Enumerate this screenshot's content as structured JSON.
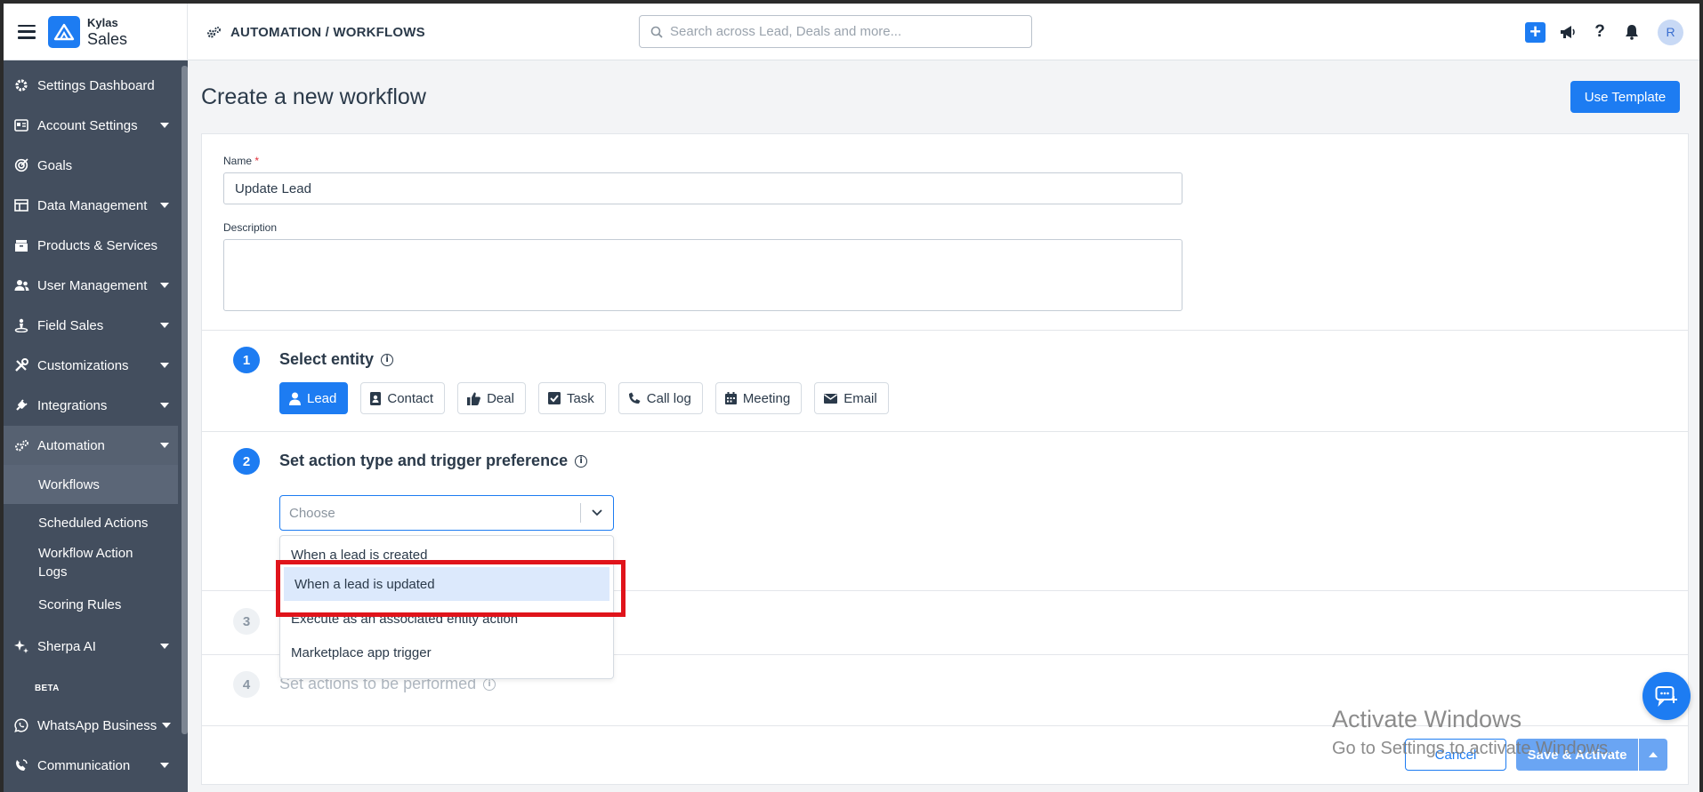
{
  "app": {
    "brand_small": "Kylas",
    "brand_big": "Sales",
    "breadcrumb": "AUTOMATION / WORKFLOWS",
    "search_placeholder": "Search across Lead, Deals and more...",
    "avatar_initial": "R",
    "accent_color": "#1d7cf2"
  },
  "sidebar": {
    "items": [
      {
        "label": "Settings Dashboard",
        "icon": "gear-icon"
      },
      {
        "label": "Account Settings",
        "icon": "id-card-icon"
      },
      {
        "label": "Goals",
        "icon": "target-icon"
      },
      {
        "label": "Data Management",
        "icon": "table-icon"
      },
      {
        "label": "Products & Services",
        "icon": "box-icon"
      },
      {
        "label": "User Management",
        "icon": "users-icon"
      },
      {
        "label": "Field Sales",
        "icon": "person-pin-icon"
      },
      {
        "label": "Customizations",
        "icon": "tools-icon"
      },
      {
        "label": "Integrations",
        "icon": "plug-icon"
      },
      {
        "label": "Automation",
        "icon": "cogs-icon"
      },
      {
        "label": "Sherpa AI",
        "icon": "sparkle-icon"
      },
      {
        "label": "WhatsApp Business",
        "icon": "whatsapp-icon"
      },
      {
        "label": "Communication",
        "icon": "satellite-icon"
      }
    ],
    "sub_items": [
      {
        "label": "Workflows"
      },
      {
        "label": "Scheduled Actions"
      },
      {
        "label": "Workflow Action Logs"
      },
      {
        "label": "Scoring Rules"
      }
    ],
    "beta_badge": "BETA"
  },
  "page": {
    "title": "Create a new workflow",
    "use_template_label": "Use Template",
    "name_label": "Name",
    "required_mark": "*",
    "name_value": "Update Lead",
    "description_label": "Description",
    "description_value": ""
  },
  "steps": [
    {
      "number": "1",
      "title": "Select entity"
    },
    {
      "number": "2",
      "title": "Set action type and trigger preference"
    },
    {
      "number": "3",
      "title": ""
    },
    {
      "number": "4",
      "title": "Set actions to be performed"
    }
  ],
  "entities": [
    {
      "label": "Lead",
      "icon": "user-icon",
      "selected": true
    },
    {
      "label": "Contact",
      "icon": "contact-card-icon",
      "selected": false
    },
    {
      "label": "Deal",
      "icon": "thumbs-up-icon",
      "selected": false
    },
    {
      "label": "Task",
      "icon": "checkbox-icon",
      "selected": false
    },
    {
      "label": "Call log",
      "icon": "phone-icon",
      "selected": false
    },
    {
      "label": "Meeting",
      "icon": "calendar-icon",
      "selected": false
    },
    {
      "label": "Email",
      "icon": "envelope-icon",
      "selected": false
    }
  ],
  "trigger_select": {
    "placeholder": "Choose",
    "options": [
      {
        "label": "When a lead is created"
      },
      {
        "label": "When a lead is updated"
      },
      {
        "label": "Execute as an associated entity action"
      },
      {
        "label": "Marketplace app trigger"
      }
    ],
    "highlighted_option": "When a lead is updated"
  },
  "footer": {
    "cancel_label": "Cancel",
    "save_label": "Save & Activate"
  },
  "watermark": {
    "line1": "Activate Windows",
    "line2": "Go to Settings to activate Windows."
  }
}
